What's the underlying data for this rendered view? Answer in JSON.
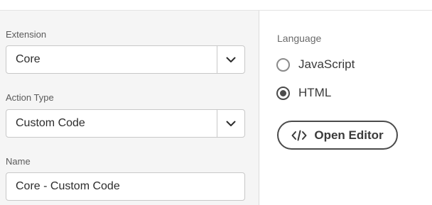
{
  "left": {
    "extension": {
      "label": "Extension",
      "value": "Core"
    },
    "action_type": {
      "label": "Action Type",
      "value": "Custom Code"
    },
    "name": {
      "label": "Name",
      "value": "Core - Custom Code"
    }
  },
  "right": {
    "language_label": "Language",
    "options": [
      {
        "label": "JavaScript",
        "selected": false
      },
      {
        "label": "HTML",
        "selected": true
      }
    ],
    "open_editor_label": "Open Editor"
  },
  "icons": {
    "picker": "chevron-down-icon",
    "editor": "code-icon"
  }
}
